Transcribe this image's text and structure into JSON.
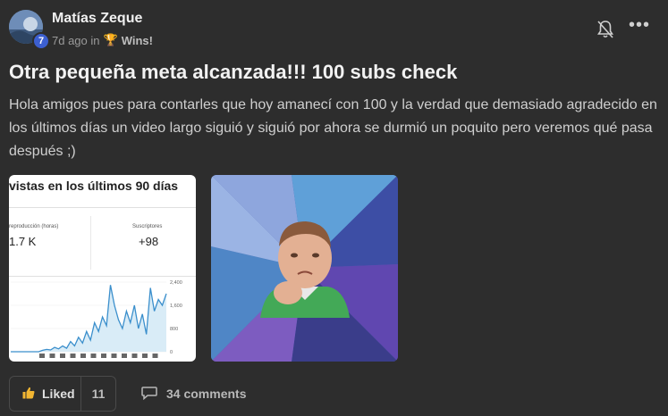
{
  "author": {
    "name": "Matías Zeque",
    "level": "7"
  },
  "meta": {
    "time": "7d ago in",
    "category": "Wins!"
  },
  "icons": {
    "bell": "bell-muted-icon",
    "more": "more-horizontal-icon",
    "like": "thumbs-up-icon",
    "comment": "comment-icon",
    "trophy": "trophy-icon"
  },
  "post": {
    "title": "Otra pequeña meta alcanzada!!! 100 subs check",
    "body": "Hola amigos pues para contarles que hoy amanecí con 100 y la verdad que demasiado agradecido en los últimos días un video largo siguió y siguió por ahora se durmió un poquito pero veremos qué pasa después ;)"
  },
  "attachment_stats": {
    "title": "vistas en los últimos 90 días",
    "metric_left_label": "reproducción (horas)",
    "metric_left_value": "1.7 K",
    "metric_right_label": "Suscriptores",
    "metric_right_value": "+98",
    "y_ticks": [
      "2,400",
      "1,600",
      "800",
      "0"
    ]
  },
  "chart_data": {
    "type": "area",
    "title": "vistas en los últimos 90 días",
    "y_ticks": [
      2400,
      1600,
      800,
      0
    ],
    "ylim": [
      0,
      2400
    ],
    "x": [
      0,
      1,
      2,
      3,
      4,
      5,
      6,
      7,
      8,
      9,
      10,
      11,
      12,
      13,
      14,
      15,
      16,
      17,
      18,
      19,
      20,
      21,
      22,
      23,
      24,
      25,
      26,
      27,
      28,
      29,
      30,
      31,
      32,
      33,
      34,
      35,
      36,
      37,
      38,
      39
    ],
    "values": [
      0,
      0,
      0,
      0,
      0,
      0,
      0,
      0,
      50,
      80,
      60,
      150,
      100,
      200,
      120,
      350,
      200,
      500,
      300,
      700,
      400,
      1000,
      700,
      1200,
      900,
      2300,
      1600,
      1100,
      800,
      1400,
      1000,
      1600,
      800,
      1300,
      600,
      2200,
      1400,
      1800,
      1600,
      2000
    ]
  },
  "actions": {
    "like_label": "Liked",
    "like_count": "11",
    "comments_label": "34 comments"
  }
}
